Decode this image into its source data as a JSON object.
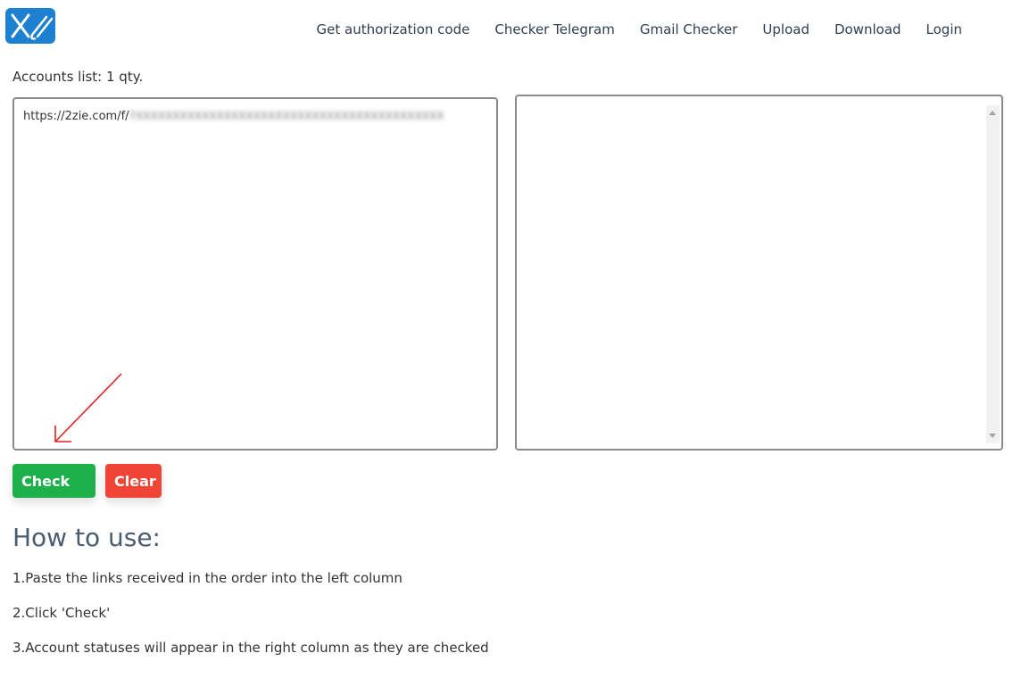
{
  "header": {
    "logo_icon": "logo-icon",
    "nav": [
      "Get authorization code",
      "Checker Telegram",
      "Gmail Checker",
      "Upload",
      "Download",
      "Login"
    ]
  },
  "main": {
    "accounts_label": "Accounts list: 1 qty.",
    "left_column_text": "https://2zie.com/f/",
    "right_column_text": "",
    "check_label": "Check",
    "clear_label": "Clear"
  },
  "howto": {
    "title": "How to use:",
    "steps": [
      "1.Paste the links received in the order into the left column",
      "2.Click 'Check'",
      "3.Account statuses will appear in the right column as they are checked"
    ]
  },
  "colors": {
    "accent": "#1e80d0",
    "check": "#1db04b",
    "clear": "#f04536",
    "arrow": "#e02020"
  }
}
